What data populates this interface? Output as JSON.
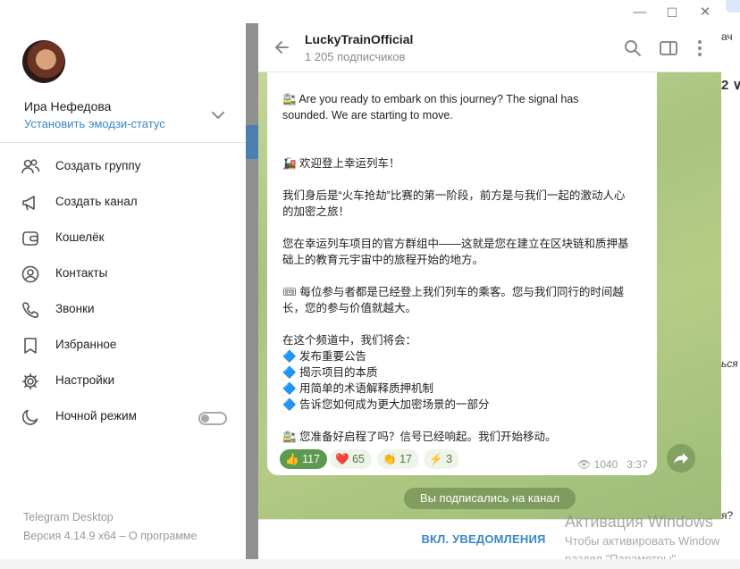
{
  "window": {
    "minimize": "—",
    "maximize": "☐",
    "close": "✕"
  },
  "background_right": {
    "top_text": "ач",
    "partial_text_1": "2 ∨",
    "partial_text_2": "ься",
    "partial_text_3": "я?"
  },
  "menu": {
    "user_name": "Ира Нефедова",
    "emoji_status_link": "Установить эмодзи-статус",
    "items": [
      {
        "label": "Создать группу",
        "icon": "people-icon"
      },
      {
        "label": "Создать канал",
        "icon": "megaphone-icon"
      },
      {
        "label": "Кошелёк",
        "icon": "wallet-icon"
      },
      {
        "label": "Контакты",
        "icon": "contact-icon"
      },
      {
        "label": "Звонки",
        "icon": "phone-icon"
      },
      {
        "label": "Избранное",
        "icon": "bookmark-icon"
      },
      {
        "label": "Настройки",
        "icon": "gear-icon"
      },
      {
        "label": "Ночной режим",
        "icon": "moon-icon",
        "toggle": false
      }
    ],
    "app_name": "Telegram Desktop",
    "app_version": "Версия 4.14.9 x64 – О программе"
  },
  "chat": {
    "title": "LuckyTrainOfficial",
    "subscribers": "1 205 подписчиков",
    "message_lines": [
      "🚉 Are you ready to embark on this journey? The signal has",
      "sounded. We are starting to move.",
      "",
      "",
      "🚂 欢迎登上幸运列车！",
      "",
      "我们身后是“火车抢劫”比赛的第一阶段，前方是与我们一起的激动人心",
      "的加密之旅！",
      "",
      "您在幸运列车项目的官方群组中——这就是您在建立在区块链和质押基",
      "础上的教育元宇宙中的旅程开始的地方。",
      "",
      "🎟 每位参与者都是已经登上我们列车的乘客。您与我们同行的时间越",
      "长，您的参与价值就越大。",
      "",
      "在这个频道中，我们将会：",
      "🔷 发布重要公告",
      "🔷 揭示项目的本质",
      "🔷 用简单的术语解释质押机制",
      "🔷 告诉您如何成为更大加密场景的一部分",
      "",
      "🚉 您准备好启程了吗？信号已经响起。我们开始移动。"
    ],
    "reactions": [
      {
        "emoji": "👍",
        "count": "117"
      },
      {
        "emoji": "❤️",
        "count": "65"
      },
      {
        "emoji": "👏",
        "count": "17"
      },
      {
        "emoji": "⚡",
        "count": "3"
      }
    ],
    "views": "1040",
    "time": "3:37",
    "subscribed_notice": "Вы подписались на канал",
    "notifications_button": "ВКЛ. УВЕДОМЛЕНИЯ"
  },
  "watermark": {
    "title": "Активация Windows",
    "line1": "Чтобы активировать Window",
    "line2": "раздел \"Параметры\"."
  }
}
